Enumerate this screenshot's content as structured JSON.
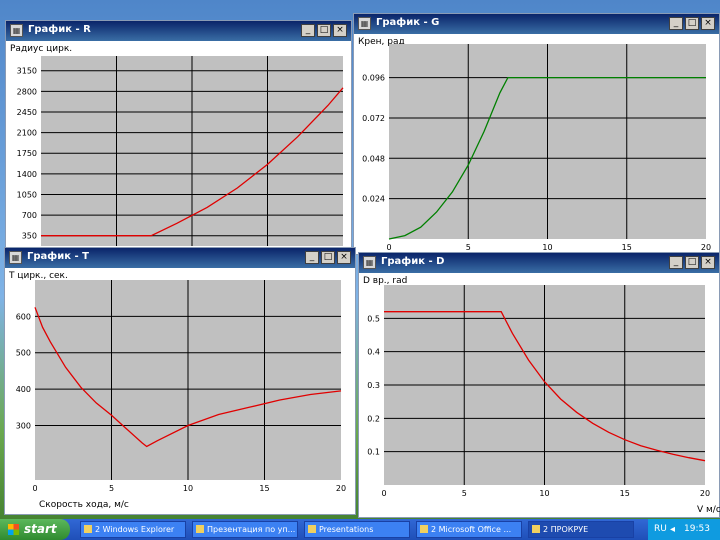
{
  "windows": [
    {
      "id": "R",
      "title": "График - R",
      "ylabel": "Радиус цирк.",
      "xlabel": "",
      "ticons": [
        "_",
        "□",
        "×"
      ]
    },
    {
      "id": "G",
      "title": "График - G",
      "ylabel": "Крен, рад",
      "xlabel": "",
      "ticons": [
        "_",
        "□",
        "×"
      ]
    },
    {
      "id": "T",
      "title": "График - T",
      "ylabel": "Т цирк., сек.",
      "xlabel": "Скорость хода, м/с",
      "ticons": [
        "_",
        "□",
        "×"
      ]
    },
    {
      "id": "D",
      "title": "График - D",
      "ylabel": "D вр., rad",
      "xlabel": "V м/с",
      "ticons": [
        "_",
        "□",
        "×"
      ]
    }
  ],
  "chart_data": [
    {
      "type": "line",
      "title": "График - R",
      "ylabel": "Радиус цирк.",
      "y_ticks": [
        "350",
        "700",
        "1050",
        "1400",
        "1750",
        "2100",
        "2450",
        "2800",
        "3150"
      ],
      "x_ticks": [],
      "xlim": [
        0,
        20
      ],
      "ylim": [
        175,
        3400
      ],
      "grid": true,
      "color": "#e00000",
      "series": [
        {
          "x": [
            0,
            2,
            4,
            6,
            7.3,
            9,
            11,
            13,
            15,
            17,
            19,
            20
          ],
          "y": [
            350,
            350,
            350,
            350,
            350,
            560,
            830,
            1160,
            1560,
            2030,
            2560,
            2860
          ]
        }
      ]
    },
    {
      "type": "line",
      "title": "График - G",
      "ylabel": "Крен, рад",
      "y_ticks": [
        "0.024",
        "0.048",
        "0.072",
        "0.096"
      ],
      "x_ticks": [
        "0",
        "5",
        "10",
        "15",
        "20"
      ],
      "xlim": [
        0,
        20
      ],
      "ylim": [
        0,
        0.116
      ],
      "grid": true,
      "color": "#008000",
      "series": [
        {
          "x": [
            0,
            1,
            2,
            3,
            4,
            5,
            6,
            7,
            7.5,
            10,
            15,
            20
          ],
          "y": [
            0,
            0.002,
            0.007,
            0.016,
            0.028,
            0.044,
            0.064,
            0.087,
            0.096,
            0.096,
            0.096,
            0.096
          ]
        }
      ]
    },
    {
      "type": "line",
      "title": "График - T",
      "ylabel": "Т цирк., сек.",
      "y_ticks": [
        "300",
        "400",
        "500",
        "600"
      ],
      "x_ticks": [
        "0",
        "5",
        "10",
        "15",
        "20"
      ],
      "xlim": [
        0,
        20
      ],
      "ylim": [
        150,
        700
      ],
      "grid": true,
      "color": "#e00000",
      "series": [
        {
          "x": [
            0,
            0.5,
            1,
            2,
            3,
            4,
            5,
            6,
            7,
            7.3,
            8,
            10,
            12,
            14,
            16,
            18,
            20
          ],
          "y": [
            625,
            570,
            530,
            460,
            405,
            362,
            328,
            290,
            252,
            242,
            258,
            300,
            330,
            350,
            370,
            385,
            395
          ]
        }
      ]
    },
    {
      "type": "line",
      "title": "График - D",
      "ylabel": "D вр., rad",
      "y_ticks": [
        "0.1",
        "0.2",
        "0.3",
        "0.4",
        "0.5"
      ],
      "x_ticks": [
        "0",
        "5",
        "10",
        "15",
        "20"
      ],
      "xlim": [
        0,
        20
      ],
      "ylim": [
        0,
        0.6
      ],
      "grid": true,
      "color": "#e00000",
      "series": [
        {
          "x": [
            0,
            2,
            4,
            6,
            7.3,
            8,
            9,
            10,
            11,
            12,
            13,
            14,
            15,
            16,
            17,
            18,
            19,
            20
          ],
          "y": [
            0.52,
            0.52,
            0.52,
            0.52,
            0.52,
            0.455,
            0.375,
            0.31,
            0.258,
            0.218,
            0.185,
            0.158,
            0.136,
            0.118,
            0.104,
            0.092,
            0.082,
            0.073
          ]
        }
      ]
    }
  ],
  "taskbar": {
    "start_label": "start",
    "tasks": [
      "2 Windows Explorer",
      "Презентация по уп...",
      "Presentations",
      "2 Microsoft Office ...",
      "2 ПРОКРУЕ"
    ],
    "lang": "RU",
    "time": "19:53"
  }
}
